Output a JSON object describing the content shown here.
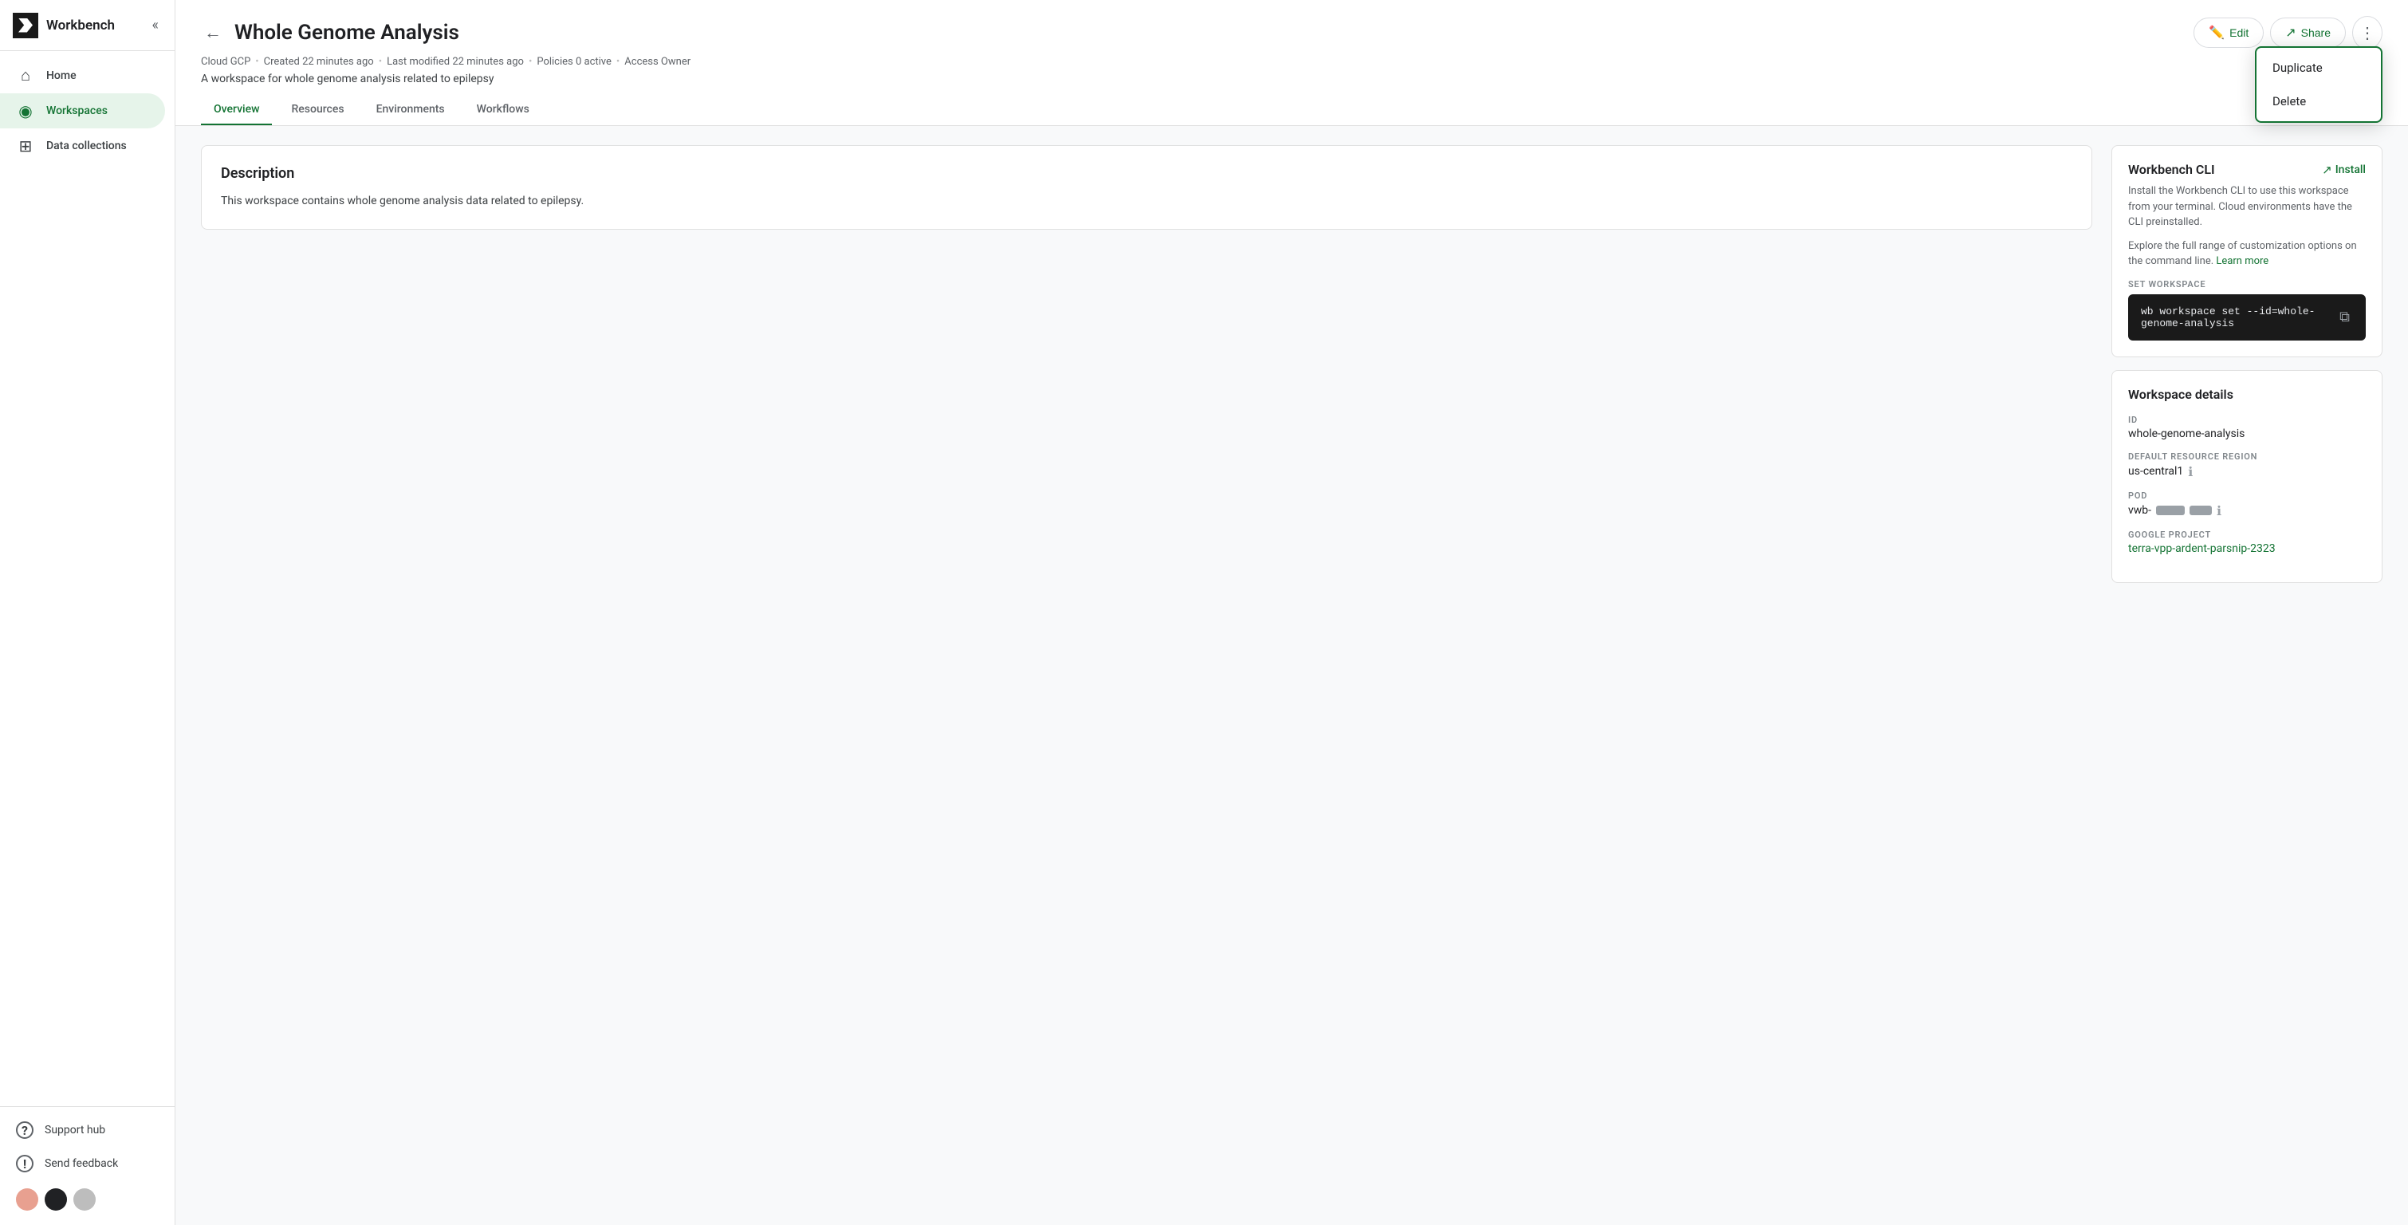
{
  "sidebar": {
    "brand": "Workbench",
    "collapse_icon": "«",
    "items": [
      {
        "id": "home",
        "label": "Home",
        "icon": "⌂",
        "active": false
      },
      {
        "id": "workspaces",
        "label": "Workspaces",
        "icon": "◉",
        "active": true
      },
      {
        "id": "data-collections",
        "label": "Data collections",
        "icon": "⊞",
        "active": false
      }
    ],
    "bottom_items": [
      {
        "id": "support-hub",
        "label": "Support hub",
        "icon": "?"
      },
      {
        "id": "send-feedback",
        "label": "Send feedback",
        "icon": "!"
      }
    ],
    "avatars": [
      "#e8a090",
      "#202124",
      "#bdbdbd"
    ]
  },
  "header": {
    "back_icon": "←",
    "title": "Whole Genome Analysis",
    "meta": {
      "cloud": "Cloud GCP",
      "created": "Created 22 minutes ago",
      "modified": "Last modified 22 minutes ago",
      "policies": "Policies 0 active",
      "access": "Access Owner"
    },
    "description": "A workspace for whole genome analysis related to epilepsy",
    "edit_label": "Edit",
    "share_label": "Share",
    "more_icon": "⋮"
  },
  "tabs": [
    {
      "id": "overview",
      "label": "Overview",
      "active": true
    },
    {
      "id": "resources",
      "label": "Resources",
      "active": false
    },
    {
      "id": "environments",
      "label": "Environments",
      "active": false
    },
    {
      "id": "workflows",
      "label": "Workflows",
      "active": false
    }
  ],
  "dropdown": {
    "items": [
      {
        "id": "duplicate",
        "label": "Duplicate"
      },
      {
        "id": "delete",
        "label": "Delete"
      }
    ]
  },
  "description_section": {
    "heading": "Description",
    "text": "This workspace contains whole genome analysis data related to epilepsy."
  },
  "cli_card": {
    "title": "Workbench CLI",
    "install_label": "Install",
    "body1": "Install the Workbench CLI to use this workspace from your terminal. Cloud environments have the CLI preinstalled.",
    "body2_prefix": "Explore the full range of customization options on the command line.",
    "learn_more_label": "Learn more",
    "set_workspace_label": "SET WORKSPACE",
    "command_line1": "wb workspace set --id=whole-",
    "command_line2": "genome-analysis",
    "copy_icon": "⧉"
  },
  "details_card": {
    "title": "Workspace details",
    "id_label": "ID",
    "id_value": "whole-genome-analysis",
    "region_label": "DEFAULT RESOURCE REGION",
    "region_value": "us-central1",
    "pod_label": "POD",
    "pod_prefix": "vwb-",
    "pod_suffix": "",
    "google_project_label": "GOOGLE PROJECT",
    "google_project_value": "terra-vpp-ardent-parsnip-2323"
  }
}
